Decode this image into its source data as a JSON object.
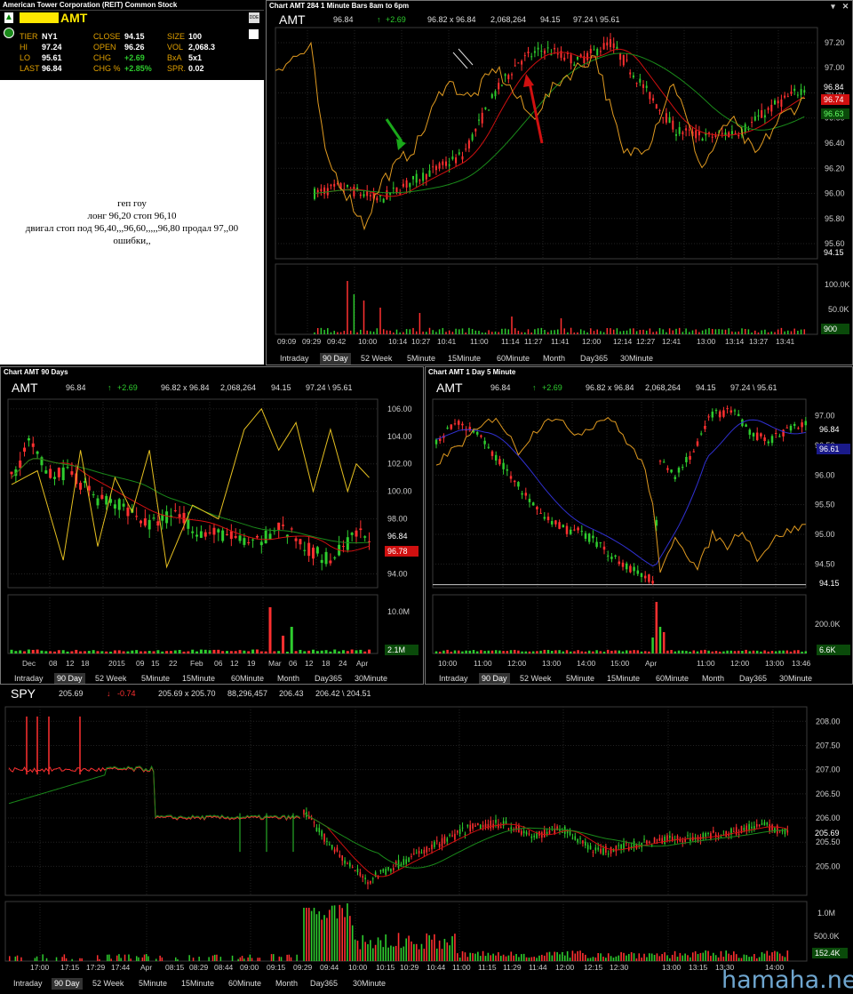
{
  "quote": {
    "title": "American Tower Corporation (REIT) Common Stock",
    "symbol": "AMT",
    "tier_label": "TIER",
    "tier": "NY1",
    "hi_label": "HI",
    "hi": "97.24",
    "lo_label": "LO",
    "lo": "95.61",
    "last_label": "LAST",
    "last": "96.84",
    "close_label": "CLOSE",
    "close": "94.15",
    "open_label": "OPEN",
    "open": "96.26",
    "chg_label": "CHG",
    "chg": "+2.69",
    "chgp_label": "CHG %",
    "chgp": "+2.85%",
    "size_label": "SIZE",
    "size": "100",
    "vol_label": "VOL",
    "vol": "2,068.3",
    "bxa_label": "BxA",
    "bxa": "5x1",
    "spr_label": "SPR.",
    "spr": "0.02",
    "btn_label": "DDE"
  },
  "notes": [
    "геп гоу",
    "лонг 96,20 стоп 96,10",
    "двигал  стоп под 96,40,,,96,60,,,,,96,80  продал 97,,00",
    "ошибки,,"
  ],
  "chart1": {
    "title": "Chart AMT 284 1 Minute Bars 8am to 6pm",
    "symbol": "AMT",
    "last": "96.84",
    "chg": "+2.69",
    "bidask": "96.82 x 96.84",
    "vol": "2,068,264",
    "close": "94.15",
    "range": "97.24 \\ 95.61",
    "yticks": [
      "97.20",
      "97.00",
      "96.80",
      "96.60",
      "96.40",
      "96.20",
      "96.00",
      "95.80",
      "95.60"
    ],
    "tag_last": "96.84",
    "tag_ma": "96.74",
    "tag_ma2": "96.63",
    "tag_close": "94.15",
    "vticks": [
      "100.0K",
      "50.0K"
    ],
    "tag_vol": "900",
    "xticks": [
      "09:09",
      "09:29",
      "09:42",
      "10:00",
      "10:14",
      "10:27",
      "10:41",
      "11:00",
      "11:14",
      "11:27",
      "11:41",
      "12:00",
      "12:14",
      "12:27",
      "12:41",
      "13:00",
      "13:14",
      "13:27",
      "13:41"
    ]
  },
  "chart2": {
    "title": "Chart AMT 90 Days",
    "symbol": "AMT",
    "last": "96.84",
    "chg": "+2.69",
    "bidask": "96.82 x 96.84",
    "vol": "2,068,264",
    "close": "94.15",
    "range": "97.24 \\ 95.61",
    "yticks": [
      "106.00",
      "104.00",
      "102.00",
      "100.00",
      "98.00",
      "94.00"
    ],
    "tag_last": "96.84",
    "tag_ma": "96.78",
    "vticks": [
      "10.0M"
    ],
    "tag_vol": "2.1M",
    "xticks": [
      "Dec",
      "08",
      "12",
      "18",
      "2015",
      "09",
      "15",
      "22",
      "Feb",
      "06",
      "12",
      "19",
      "Mar",
      "06",
      "12",
      "18",
      "24",
      "Apr"
    ]
  },
  "chart3": {
    "title": "Chart AMT 1 Day 5 Minute",
    "symbol": "AMT",
    "last": "96.84",
    "chg": "+2.69",
    "bidask": "96.82 x 96.84",
    "vol": "2,068,264",
    "close": "94.15",
    "range": "97.24 \\ 95.61",
    "yticks": [
      "97.00",
      "96.50",
      "96.00",
      "95.50",
      "95.00",
      "94.50"
    ],
    "tag_last": "96.84",
    "tag_ma": "96.61",
    "tag_close": "94.15",
    "vticks": [
      "200.0K"
    ],
    "tag_vol": "6.6K",
    "xticks": [
      "10:00",
      "11:00",
      "12:00",
      "13:00",
      "14:00",
      "15:00",
      "Apr",
      "11:00",
      "12:00",
      "13:00",
      "13:46"
    ]
  },
  "chart4": {
    "symbol": "SPY",
    "last": "205.69",
    "chg": "-0.74",
    "bidask": "205.69 x 205.70",
    "vol": "88,296,457",
    "close": "206.43",
    "range": "206.42 \\ 204.51",
    "yticks": [
      "208.00",
      "207.50",
      "207.00",
      "206.50",
      "206.00",
      "205.50",
      "205.00"
    ],
    "tag_last": "205.69",
    "vticks": [
      "1.0M",
      "500.0K"
    ],
    "tag_vol": "152.4K",
    "xticks": [
      "17:00",
      "17:15",
      "17:29",
      "17:44",
      "Apr",
      "08:15",
      "08:29",
      "08:44",
      "09:00",
      "09:15",
      "09:29",
      "09:44",
      "10:00",
      "10:15",
      "10:29",
      "10:44",
      "11:00",
      "11:15",
      "11:29",
      "11:44",
      "12:00",
      "12:15",
      "12:30",
      "13:00",
      "13:15",
      "13:30",
      "14:00"
    ]
  },
  "tabs": [
    "Intraday",
    "90 Day",
    "52 Week",
    "5Minute",
    "15Minute",
    "60Minute",
    "Month",
    "Day365",
    "30Minute"
  ],
  "watermark": "hamaha.net",
  "colors": {
    "up": "#2ecc2e",
    "down": "#ff3030",
    "ma_red": "#d01010",
    "ma_green": "#1a8a1a",
    "overlay": "#e09a20",
    "ma_blue": "#3030d0"
  }
}
